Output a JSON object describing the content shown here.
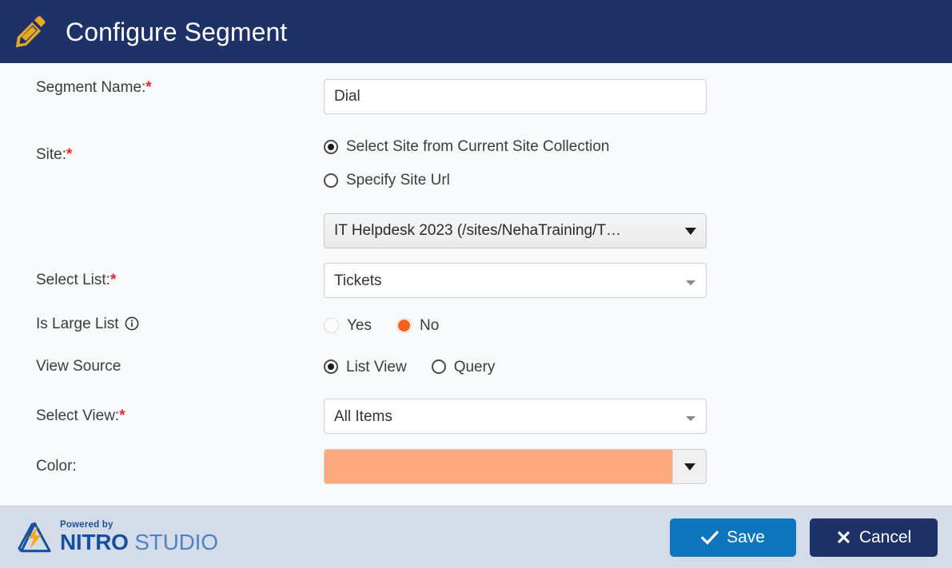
{
  "header": {
    "icon": "pencil-icon",
    "title": "Configure Segment",
    "background_color": "#1E3268",
    "icon_color": "#E9A826"
  },
  "form": {
    "fields": [
      {
        "key": "segment_name",
        "label": "Segment Name:",
        "required": true,
        "type": "text",
        "value": "Dial",
        "placeholder": ""
      },
      {
        "key": "site",
        "label": "Site:",
        "required": true,
        "type": "radio-group",
        "options": [
          {
            "label": "Select Site from Current Site Collection",
            "checked": true
          },
          {
            "label": "Specify Site Url",
            "checked": false
          }
        ],
        "site_dropdown": {
          "value": "IT Helpdesk 2023 (/sites/NehaTraining/T…",
          "icon": "caret-down-icon"
        }
      },
      {
        "key": "select_list",
        "label": "Select List:",
        "required": true,
        "type": "select",
        "value": "Tickets",
        "icon": "chevron-down-icon"
      },
      {
        "key": "is_large_list",
        "label": "Is Large List",
        "required": false,
        "info_icon": "info-icon",
        "type": "radio-group",
        "options": [
          {
            "label": "Yes",
            "checked": false
          },
          {
            "label": "No",
            "checked": true
          }
        ],
        "checked_color": "#F4631E"
      },
      {
        "key": "view_source",
        "label": "View Source",
        "required": false,
        "type": "radio-group",
        "options": [
          {
            "label": "List View",
            "checked": true
          },
          {
            "label": "Query",
            "checked": false
          }
        ]
      },
      {
        "key": "select_view",
        "label": "Select View:",
        "required": true,
        "type": "select",
        "value": "All Items",
        "icon": "chevron-down-icon"
      },
      {
        "key": "color",
        "label": "Color:",
        "required": false,
        "type": "color",
        "value": "#FFA97E",
        "icon": "caret-down-icon"
      }
    ],
    "required_marker": "*"
  },
  "footer": {
    "brand": {
      "powered_by": "Powered by",
      "name_bold": "NITRO",
      "name_light": " STUDIO",
      "mark": "nitro-logo-icon"
    },
    "buttons": {
      "save": {
        "label": "Save",
        "icon": "check-icon",
        "color": "#0D76BC"
      },
      "cancel": {
        "label": "Cancel",
        "icon": "close-icon",
        "color": "#1E3268"
      }
    }
  }
}
